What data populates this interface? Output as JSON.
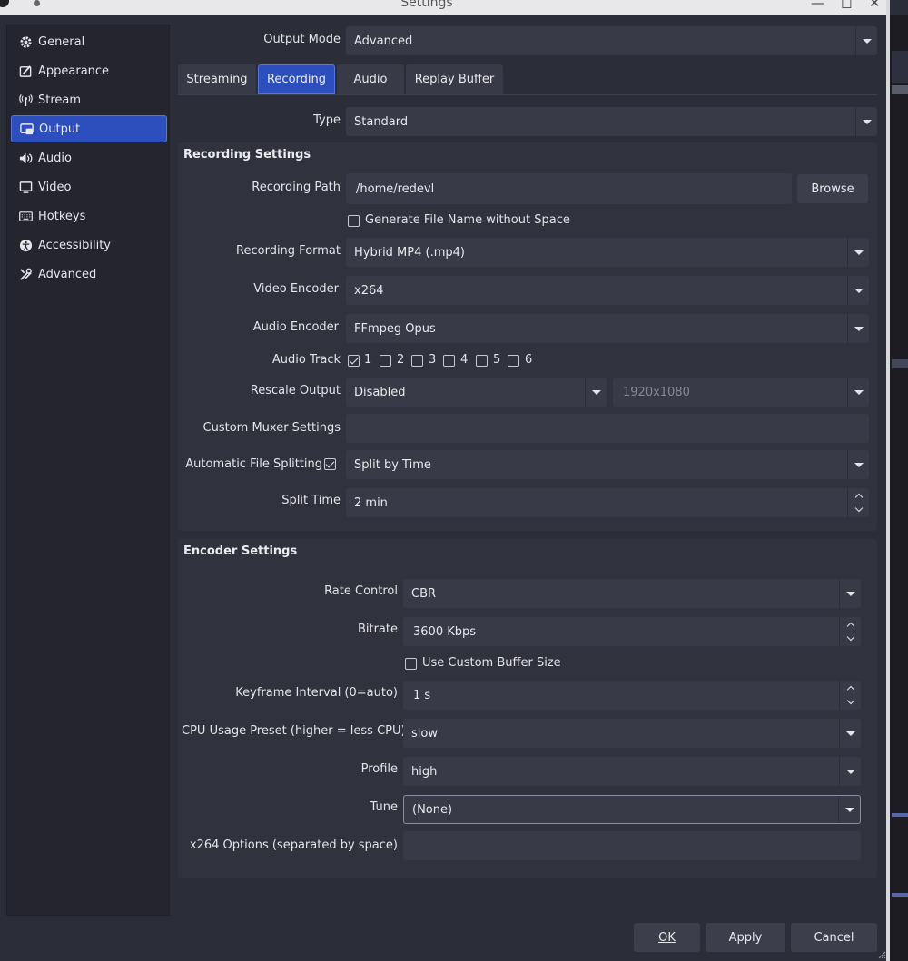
{
  "window": {
    "title": "Settings"
  },
  "sidebar": {
    "items": [
      {
        "label": "General",
        "icon": "gear-icon"
      },
      {
        "label": "Appearance",
        "icon": "appearance-icon"
      },
      {
        "label": "Stream",
        "icon": "antenna-icon"
      },
      {
        "label": "Output",
        "icon": "output-icon",
        "active": true
      },
      {
        "label": "Audio",
        "icon": "speaker-icon"
      },
      {
        "label": "Video",
        "icon": "monitor-icon"
      },
      {
        "label": "Hotkeys",
        "icon": "keyboard-icon"
      },
      {
        "label": "Accessibility",
        "icon": "accessibility-icon"
      },
      {
        "label": "Advanced",
        "icon": "tools-icon"
      }
    ]
  },
  "output_mode": {
    "label": "Output Mode",
    "value": "Advanced"
  },
  "tabs": [
    "Streaming",
    "Recording",
    "Audio",
    "Replay Buffer"
  ],
  "active_tab": "Recording",
  "type": {
    "label": "Type",
    "value": "Standard"
  },
  "recording": {
    "title": "Recording Settings",
    "path_label": "Recording Path",
    "path_value": "/home/redevl",
    "browse_label": "Browse",
    "gen_filename_label": "Generate File Name without Space",
    "gen_filename_checked": false,
    "format_label": "Recording Format",
    "format_value": "Hybrid MP4 (.mp4)",
    "video_encoder_label": "Video Encoder",
    "video_encoder_value": "x264",
    "audio_encoder_label": "Audio Encoder",
    "audio_encoder_value": "FFmpeg Opus",
    "audio_track_label": "Audio Track",
    "tracks": [
      {
        "n": "1",
        "checked": true
      },
      {
        "n": "2",
        "checked": false
      },
      {
        "n": "3",
        "checked": false
      },
      {
        "n": "4",
        "checked": false
      },
      {
        "n": "5",
        "checked": false
      },
      {
        "n": "6",
        "checked": false
      }
    ],
    "rescale_label": "Rescale Output",
    "rescale_value": "Disabled",
    "rescale_res": "1920x1080",
    "muxer_label": "Custom Muxer Settings",
    "muxer_value": "",
    "split_label": "Automatic File Splitting",
    "split_checked": true,
    "split_value": "Split by Time",
    "split_time_label": "Split Time",
    "split_time_value": "2 min"
  },
  "encoder": {
    "title": "Encoder Settings",
    "rate_label": "Rate Control",
    "rate_value": "CBR",
    "bitrate_label": "Bitrate",
    "bitrate_value": "3600 Kbps",
    "buffer_label": "Use Custom Buffer Size",
    "buffer_checked": false,
    "keyframe_label": "Keyframe Interval (0=auto)",
    "keyframe_value": "1 s",
    "cpu_label": "CPU Usage Preset (higher = less CPU)",
    "cpu_value": "slow",
    "profile_label": "Profile",
    "profile_value": "high",
    "tune_label": "Tune",
    "tune_value": "(None)",
    "options_label": "x264 Options (separated by space)",
    "options_value": ""
  },
  "footer": {
    "ok": "OK",
    "apply": "Apply",
    "cancel": "Cancel"
  }
}
